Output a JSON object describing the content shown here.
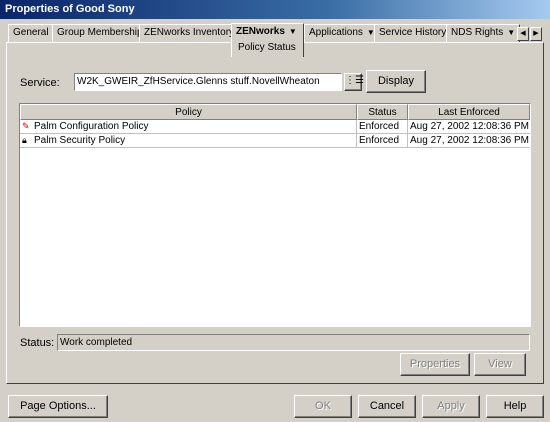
{
  "window": {
    "title": "Properties of Good Sony"
  },
  "tabs": [
    {
      "label": "General"
    },
    {
      "label": "Group Membership"
    },
    {
      "label": "ZENworks Inventory"
    },
    {
      "label": "ZENworks",
      "sub": "Policy Status",
      "active": true
    },
    {
      "label": "Applications"
    },
    {
      "label": "Service History"
    },
    {
      "label": "NDS Rights"
    }
  ],
  "service": {
    "label": "Service:",
    "value": "W2K_GWEIR_ZfHService.Glenns stuff.NovellWheaton",
    "display_button": "Display"
  },
  "table": {
    "columns": [
      "Policy",
      "Status",
      "Last Enforced"
    ],
    "rows": [
      {
        "policy": "Palm Configuration Policy",
        "status": "Enforced",
        "last_enforced": "Aug 27, 2002 12:08:36 PM",
        "icon": "palm-config-icon"
      },
      {
        "policy": "Palm Security Policy",
        "status": "Enforced",
        "last_enforced": "Aug 27, 2002 12:08:36 PM",
        "icon": "lock-icon"
      }
    ]
  },
  "status": {
    "label": "Status:",
    "value": "Work completed"
  },
  "panel_buttons": {
    "properties": "Properties",
    "view": "View"
  },
  "footer": {
    "page_options": "Page Options...",
    "ok": "OK",
    "cancel": "Cancel",
    "apply": "Apply",
    "help": "Help"
  }
}
